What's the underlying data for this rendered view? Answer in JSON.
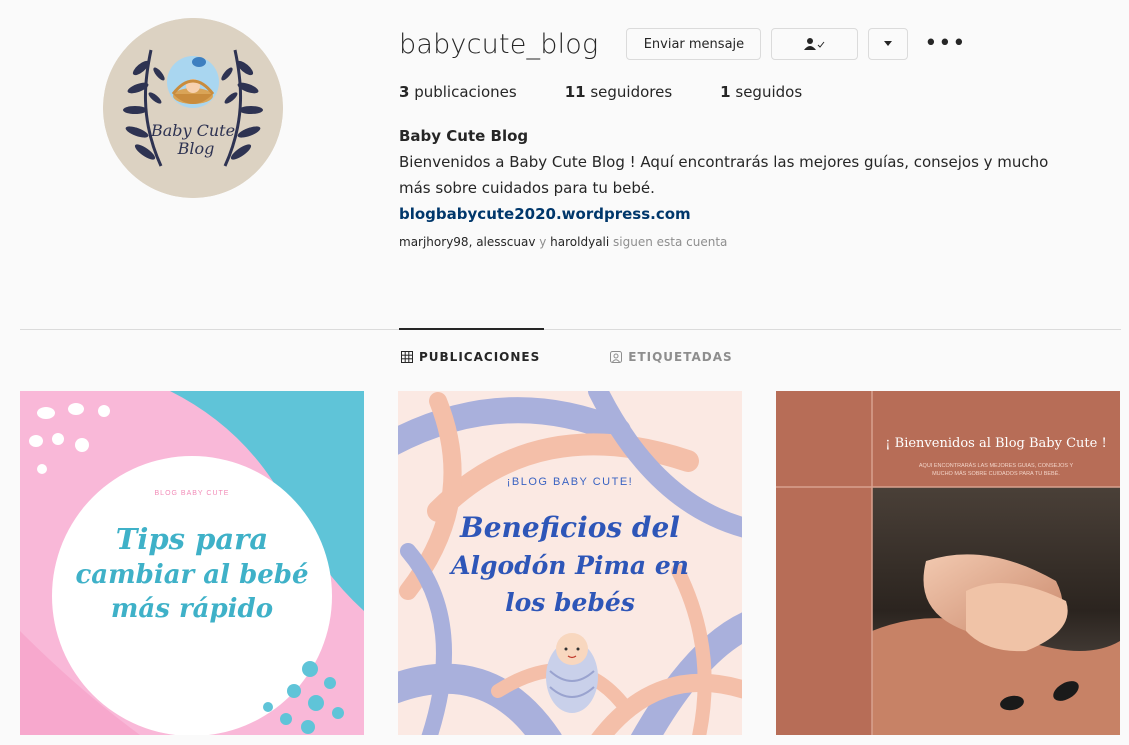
{
  "profile": {
    "username": "babycute_blog",
    "avatar_text_line1": "Baby Cute",
    "avatar_text_line2": "Blog",
    "buttons": {
      "message_label": "Enviar mensaje",
      "following_icon": "person-check-icon",
      "dropdown_icon": "caret-down-icon",
      "more_icon": "ellipsis-icon"
    },
    "stats": {
      "posts_count": "3",
      "posts_label": "publicaciones",
      "followers_count": "11",
      "followers_label": "seguidores",
      "following_count": "1",
      "following_label": "seguidos"
    },
    "bio": {
      "name": "Baby Cute Blog",
      "line1": "Bienvenidos a Baby Cute Blog ! Aquí encontrarás las mejores guías, consejos y mucho",
      "line2": "más sobre cuidados para tu bebé.",
      "link": "blogbabycute2020.wordpress.com"
    },
    "followed_by": {
      "user1": "marjhory98",
      "sep1": ", ",
      "user2": "alesscuav",
      "sep2": " y ",
      "user3": "haroldyali",
      "suffix": " siguen esta cuenta"
    }
  },
  "tabs": [
    {
      "label": "PUBLICACIONES",
      "icon": "grid-icon",
      "active": true
    },
    {
      "label": "ETIQUETADAS",
      "icon": "tag-person-icon",
      "active": false
    }
  ],
  "posts": [
    {
      "kicker": "BLOG BABY CUTE",
      "title_line1": "Tips para",
      "title_line2": "cambiar al bebé",
      "title_line3": "más rápido",
      "colors": {
        "pink": "#f9b8d8",
        "blue": "#5fc4d8",
        "text": "#3fb1c8"
      }
    },
    {
      "kicker": "¡BLOG BABY CUTE!",
      "title_line1": "Beneficios del",
      "title_line2": "Algodón Pima en",
      "title_line3": "los bebés",
      "colors": {
        "bg": "#fbe9e3",
        "stroke_blue": "#a9b0dc",
        "stroke_peach": "#f4bfa9",
        "text": "#2e56b8"
      }
    },
    {
      "title": "¡ Bienvenidos al Blog Baby Cute !",
      "subtitle_line1": "AQUI ENCONTRARÁS LAS MEJORES GUIAS, CONSEJOS Y",
      "subtitle_line2": "MUCHO MÁS SOBRE CUIDADOS PARA TU BEBÉ.",
      "colors": {
        "bg": "#b76d57",
        "line": "#d9a28f"
      }
    }
  ],
  "colors": {
    "background": "#fafafa",
    "link": "#00376b",
    "muted": "#8e8e8e",
    "border": "#dbdbdb"
  }
}
